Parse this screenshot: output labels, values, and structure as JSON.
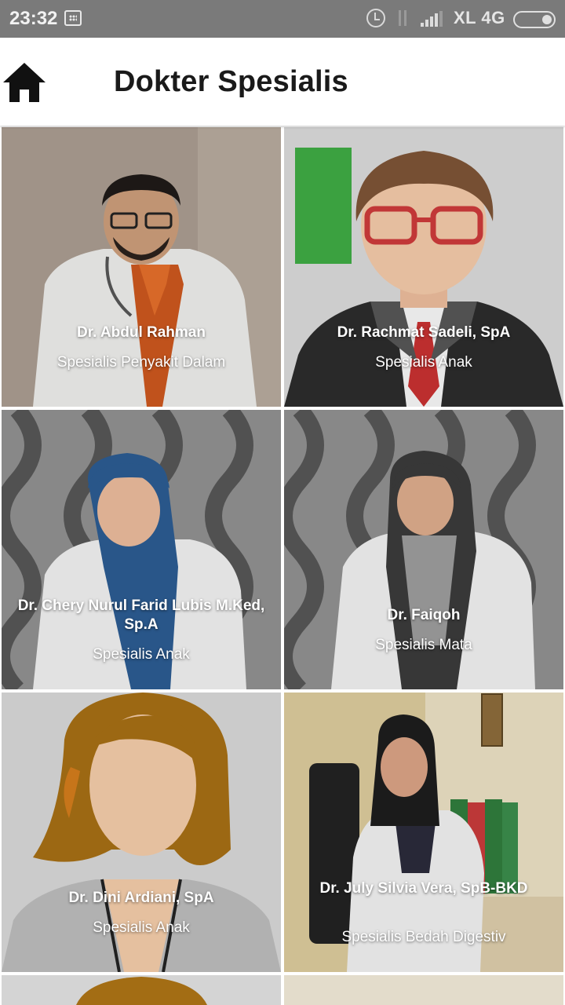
{
  "status_bar": {
    "time": "23:32",
    "carrier": "XL 4G",
    "icons": [
      "bbm-notification-icon",
      "alarm-icon",
      "data-transfer-icon",
      "signal-icon",
      "battery-icon"
    ]
  },
  "app_bar": {
    "title": "Dokter Spesialis",
    "home_icon": "home-icon"
  },
  "doctors": [
    {
      "name": "Dr. Abdul Rahman",
      "specialty": "Spesialis Penyakit Dalam"
    },
    {
      "name": "Dr. Rachmat Sadeli, SpA",
      "specialty": "Spesialis Anak"
    },
    {
      "name": "Dr. Chery Nurul Farid Lubis M.Ked, Sp.A",
      "specialty": "Spesialis Anak"
    },
    {
      "name": "Dr. Faiqoh",
      "specialty": "Spesialis Mata"
    },
    {
      "name": "Dr. Dini Ardiani, SpA",
      "specialty": "Spesialis Anak"
    },
    {
      "name": "Dr. July Silvia Vera, SpB-BKD",
      "specialty": "Spesialis Bedah Digestiv"
    }
  ],
  "colors": {
    "status_bar": "#7a7a7a",
    "app_bar": "#ffffff",
    "title_text": "#1a1a1a",
    "card_text": "#ffffff"
  }
}
